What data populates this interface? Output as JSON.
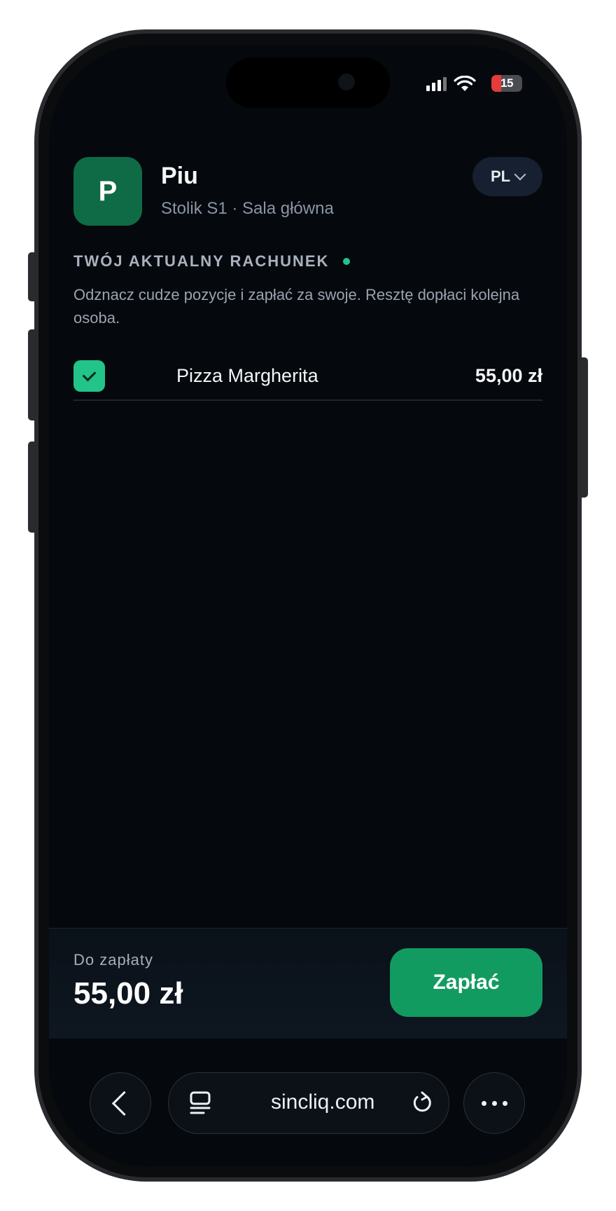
{
  "status_bar": {
    "battery": "15"
  },
  "venue": {
    "logo_letter": "P",
    "name": "Piu",
    "subtitle": "Stolik S1 · Sala główna",
    "language": "PL"
  },
  "bill": {
    "section_title": "TWÓJ AKTUALNY RACHUNEK",
    "description": "Odznacz cudze pozycje i zapłać za swoje. Resztę dopłaci kolejna osoba.",
    "items": [
      {
        "name": "Pizza Margherita",
        "price": "55,00 zł",
        "checked": true
      }
    ]
  },
  "payment": {
    "label": "Do zapłaty",
    "amount": "55,00 zł",
    "button_label": "Zapłać"
  },
  "browser": {
    "url": "sincliq.com"
  },
  "colors": {
    "accent": "#22c489",
    "pay_button": "#129b61",
    "logo_bg": "#0f6b45",
    "background": "#05080d"
  }
}
